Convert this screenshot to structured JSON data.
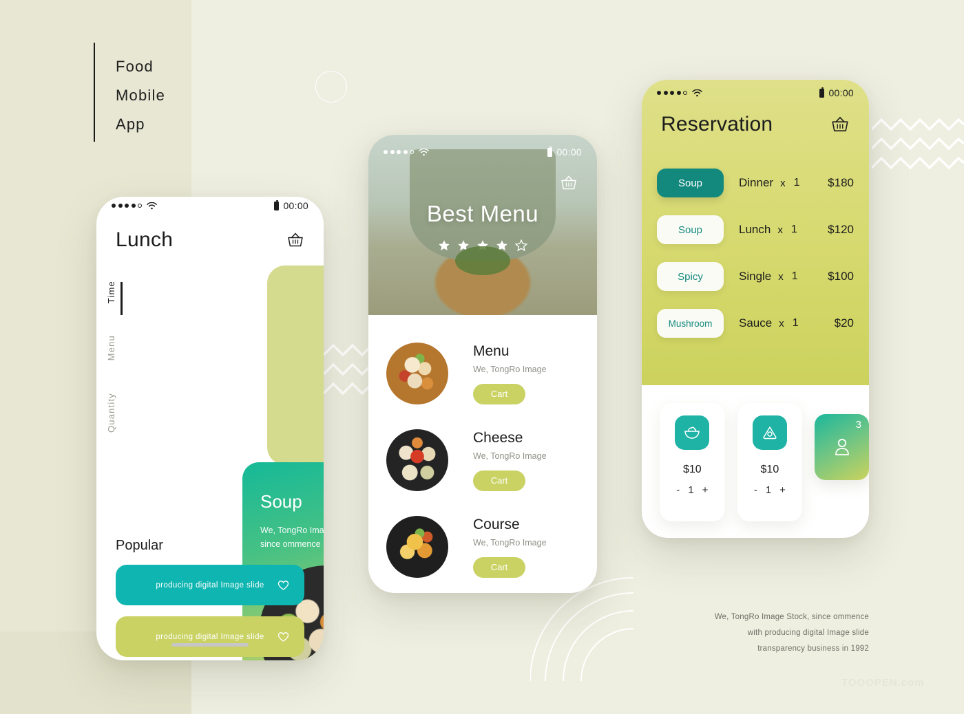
{
  "page": {
    "title_lines": [
      "Food",
      "Mobile",
      "App"
    ],
    "watermark": "TOOOPEN.com"
  },
  "colors": {
    "bg_left": "#e7e7d3",
    "bg_right": "#eeeee1",
    "teal": "#13897e",
    "teal_light": "#1fb3a6",
    "lime": "#c9d263",
    "yellow_green": "#d6d96e"
  },
  "phone1": {
    "status": {
      "time": "00:00",
      "dots": 5,
      "dots_filled": 4,
      "wifi_icon": "wifi-icon",
      "battery_icon": "battery-icon"
    },
    "header": {
      "title": "Lunch",
      "basket_icon": "basket-icon"
    },
    "tabs": [
      {
        "label": "Time",
        "active": true
      },
      {
        "label": "Menu",
        "active": false
      },
      {
        "label": "Quantity",
        "active": false
      }
    ],
    "card": {
      "title": "Soup",
      "subtitle": "We, TongRo Image Stock, since ommence",
      "add_icon": "plus-circle-icon"
    },
    "popular": {
      "heading": "Popular",
      "items": [
        {
          "label": "producing digital Image slide",
          "color": "#0fb5b0",
          "fav_icon": "heart-icon"
        },
        {
          "label": "producing digital Image slide",
          "color": "#c9d263",
          "fav_icon": "heart-icon"
        }
      ]
    }
  },
  "phone2": {
    "status": {
      "time": "00:00",
      "dots": 5,
      "dots_filled": 4,
      "wifi_icon": "wifi-icon",
      "battery_icon": "battery-icon"
    },
    "hero": {
      "title": "Best Menu",
      "basket_icon": "basket-icon",
      "rating_filled": 4,
      "rating_total": 5
    },
    "menu_items": [
      {
        "name": "Menu",
        "subtitle": "We, TongRo Image",
        "cart_label": "Cart"
      },
      {
        "name": "Cheese",
        "subtitle": "We, TongRo Image",
        "cart_label": "Cart"
      },
      {
        "name": "Course",
        "subtitle": "We, TongRo Image",
        "cart_label": "Cart"
      }
    ]
  },
  "phone3": {
    "status": {
      "time": "00:00",
      "dots": 5,
      "dots_filled": 4,
      "wifi_icon": "wifi-icon",
      "battery_icon": "battery-icon"
    },
    "header": {
      "title": "Reservation",
      "basket_icon": "basket-icon"
    },
    "reservations": [
      {
        "tag": "Soup",
        "selected": true,
        "meal": "Dinner",
        "x": "x",
        "qty": "1",
        "price": "$180"
      },
      {
        "tag": "Soup",
        "selected": false,
        "meal": "Lunch",
        "x": "x",
        "qty": "1",
        "price": "$120"
      },
      {
        "tag": "Spicy",
        "selected": false,
        "meal": "Single",
        "x": "x",
        "qty": "1",
        "price": "$100"
      },
      {
        "tag": "Mushroom",
        "selected": false,
        "meal": "Sauce",
        "x": "x",
        "qty": "1",
        "price": "$20"
      }
    ],
    "products": [
      {
        "icon": "salad-bowl-icon",
        "price": "$10",
        "minus": "-",
        "qty": "1",
        "plus": "+"
      },
      {
        "icon": "rice-ball-icon",
        "price": "$10",
        "minus": "-",
        "qty": "1",
        "plus": "+"
      }
    ],
    "people": {
      "icon": "person-icon",
      "count": "3"
    }
  },
  "footer": {
    "lines": [
      "We, TongRo Image Stock, since ommence",
      "with producing digital Image slide",
      "transparency business in 1992"
    ]
  }
}
